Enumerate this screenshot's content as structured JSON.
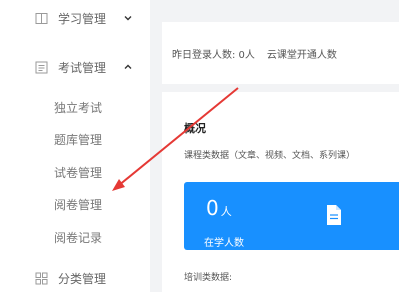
{
  "sidebar": {
    "menus": [
      {
        "label": "学习管理",
        "icon": "book-icon",
        "chevron": "chevron-down-icon"
      },
      {
        "label": "考试管理",
        "icon": "exam-icon",
        "chevron": "chevron-up-icon"
      },
      {
        "label": "分类管理",
        "icon": "grid-icon"
      }
    ],
    "exam_submenu": [
      "独立考试",
      "题库管理",
      "试卷管理",
      "阅卷管理",
      "阅卷记录"
    ]
  },
  "main": {
    "stats": {
      "login_label": "昨日登录人数: 0人",
      "cloud_label": "云课堂开通人数"
    },
    "overview_title": "概况",
    "course_data_label": "课程类数据（文章、视频、文档、系列课）",
    "card": {
      "value": "0",
      "unit": "人",
      "label": "在学人数",
      "icon": "document-icon",
      "color": "#1890ff"
    },
    "training_label": "培训类数据:"
  },
  "annotation": {
    "arrow_color": "#e53935",
    "points_to": "阅卷管理"
  }
}
